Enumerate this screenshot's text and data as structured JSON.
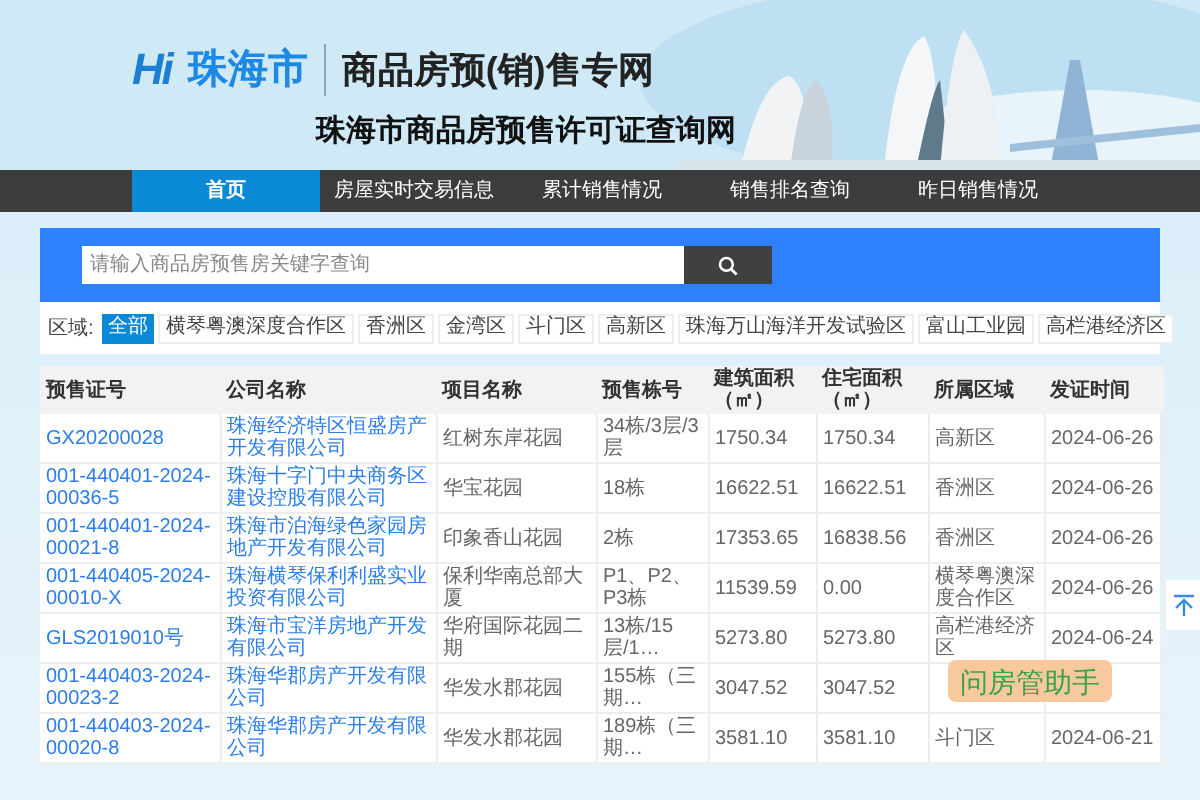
{
  "header": {
    "logo_mark": "Hi",
    "city": "珠海市",
    "site_title": "商品房预(销)售专网",
    "subtitle": "珠海市商品房预售许可证查询网"
  },
  "nav": [
    {
      "label": "首页",
      "selected": true
    },
    {
      "label": "房屋实时交易信息",
      "selected": false
    },
    {
      "label": "累计销售情况",
      "selected": false
    },
    {
      "label": "销售排名查询",
      "selected": false
    },
    {
      "label": "昨日销售情况",
      "selected": false
    }
  ],
  "search": {
    "placeholder": "请输入商品房预售房关键字查询"
  },
  "filter": {
    "label": "区域:",
    "options": [
      {
        "label": "全部",
        "selected": true
      },
      {
        "label": "横琴粤澳深度合作区",
        "selected": false
      },
      {
        "label": "香洲区",
        "selected": false
      },
      {
        "label": "金湾区",
        "selected": false
      },
      {
        "label": "斗门区",
        "selected": false
      },
      {
        "label": "高新区",
        "selected": false
      },
      {
        "label": "珠海万山海洋开发试验区",
        "selected": false
      },
      {
        "label": "富山工业园",
        "selected": false
      },
      {
        "label": "高栏港经济区",
        "selected": false
      }
    ]
  },
  "table": {
    "columns": [
      {
        "label": "预售证号",
        "kind": "link"
      },
      {
        "label": "公司名称",
        "kind": "link"
      },
      {
        "label": "项目名称",
        "kind": "text"
      },
      {
        "label": "预售栋号",
        "kind": "text"
      },
      {
        "label": "建筑面积（㎡）",
        "kind": "text"
      },
      {
        "label": "住宅面积（㎡）",
        "kind": "text"
      },
      {
        "label": "所属区域",
        "kind": "text"
      },
      {
        "label": "发证时间",
        "kind": "text"
      }
    ],
    "rows": [
      [
        "GX20200028",
        "珠海经济特区恒盛房产开发有限公司",
        "红树东岸花园",
        "34栋/3层/3层",
        "1750.34",
        "1750.34",
        "高新区",
        "2024-06-26"
      ],
      [
        "001-440401-2024-00036-5",
        "珠海十字门中央商务区建设控股有限公司",
        "华宝花园",
        "18栋",
        "16622.51",
        "16622.51",
        "香洲区",
        "2024-06-26"
      ],
      [
        "001-440401-2024-00021-8",
        "珠海市泊海绿色家园房地产开发有限公司",
        "印象香山花园",
        "2栋",
        "17353.65",
        "16838.56",
        "香洲区",
        "2024-06-26"
      ],
      [
        "001-440405-2024-00010-X",
        "珠海横琴保利利盛实业投资有限公司",
        "保利华南总部大厦",
        "P1、P2、P3栋",
        "11539.59",
        "0.00",
        "横琴粤澳深度合作区",
        "2024-06-26"
      ],
      [
        "GLS2019010号",
        "珠海市宝洋房地产开发有限公司",
        "华府国际花园二期",
        "13栋/15层/1…",
        "5273.80",
        "5273.80",
        "高栏港经济区",
        "2024-06-24"
      ],
      [
        "001-440403-2024-00023-2",
        "珠海华郡房产开发有限公司",
        "华发水郡花园",
        "155栋（三期…",
        "3047.52",
        "3047.52"
      ],
      [
        "001-440403-2024-00020-8",
        "珠海华郡房产开发有限公司",
        "华发水郡花园",
        "189栋（三期…",
        "3581.10",
        "3581.10",
        "斗门区",
        "2024-06-21"
      ]
    ]
  },
  "assistant": {
    "label": "问房管助手"
  }
}
